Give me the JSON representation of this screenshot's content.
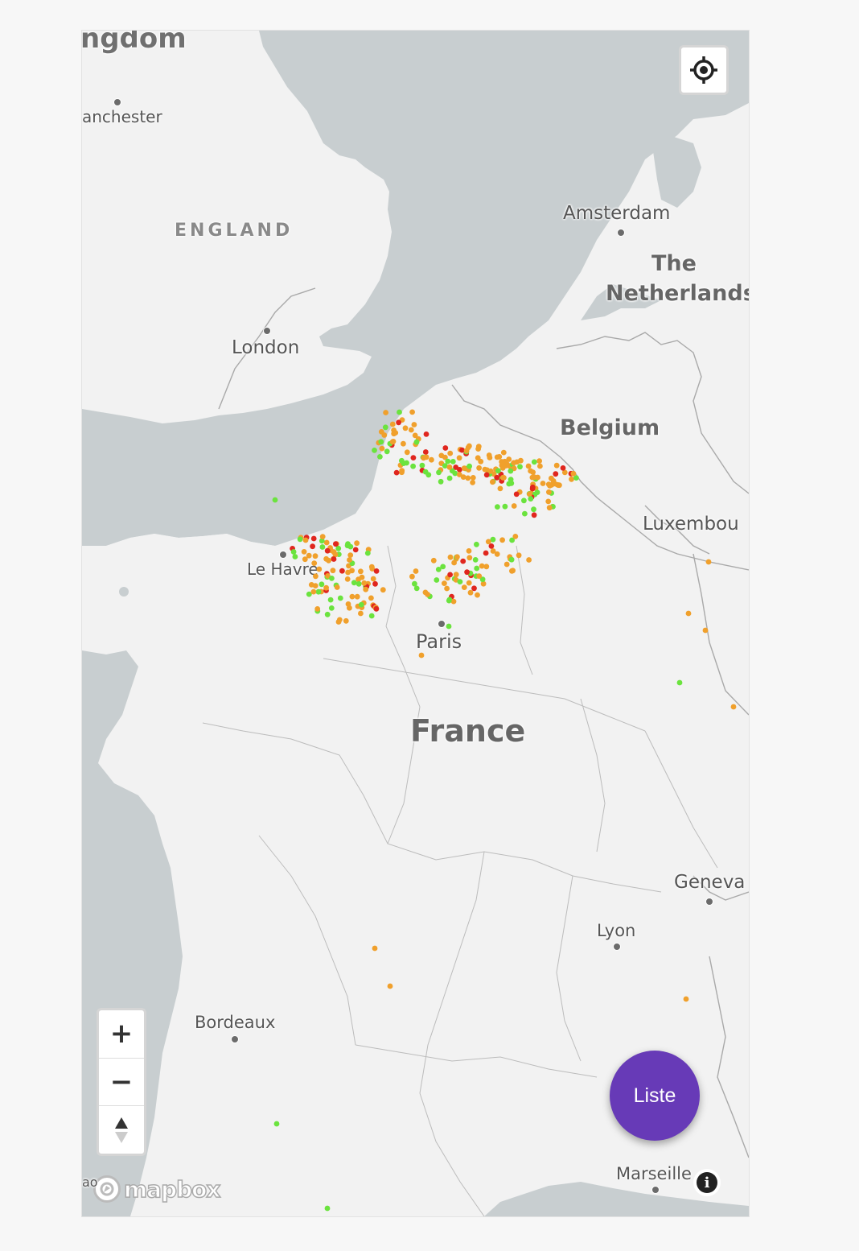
{
  "map": {
    "colors": {
      "water": "#c8ced0",
      "land": "#f2f2f2",
      "border": "#a9a9a9",
      "marker_green": "#6be33e",
      "marker_orange": "#f0a02c",
      "marker_red": "#e0261e",
      "accent": "#673ab7"
    },
    "labels": {
      "kingdom": "ngdom",
      "manchester": "anchester",
      "england": "ENGLAND",
      "london": "London",
      "amsterdam": "Amsterdam",
      "netherlands_1": "The",
      "netherlands_2": "Netherlands",
      "belgium": "Belgium",
      "luxembourg": "Luxembou",
      "le_havre": "Le Havre",
      "paris": "Paris",
      "france": "France",
      "geneva": "Geneva",
      "lyon": "Lyon",
      "bordeaux": "Bordeaux",
      "marseille": "Marseille"
    },
    "icons": {
      "locate": "crosshair-icon",
      "info": "info-icon",
      "mapbox": "mapbox-logo"
    }
  },
  "controls": {
    "zoom_in": "+",
    "zoom_out": "−",
    "compass": "▲",
    "info": "i",
    "mapbox_text": "mapbox",
    "attribution_clip": "ao"
  },
  "fab": {
    "label": "Liste"
  }
}
